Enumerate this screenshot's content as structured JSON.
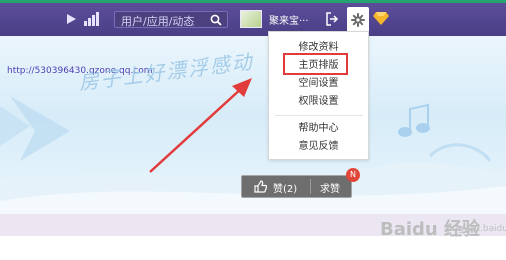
{
  "topbar": {
    "search_placeholder": "用户/应用/动态",
    "username": "聚来宝···"
  },
  "page": {
    "url": "http://530396430.qzone.qq.com",
    "banner_handwriting": "房子上好漂浮感动"
  },
  "dropdown": {
    "items": [
      {
        "label": "修改资料"
      },
      {
        "label": "主页排版"
      },
      {
        "label": "空间设置"
      },
      {
        "label": "权限设置"
      },
      {
        "label": "帮助中心"
      },
      {
        "label": "意见反馈"
      }
    ]
  },
  "feed": {
    "like_label": "赞(2)",
    "ask_label": "求赞",
    "badge": "N"
  },
  "watermark": {
    "text": "Baidu 经验",
    "sub": "jingyan.baidu.com"
  },
  "colors": {
    "topbar": "#4a3f86",
    "highlight": "#e23b3b",
    "arrow": "#e23b3b"
  }
}
